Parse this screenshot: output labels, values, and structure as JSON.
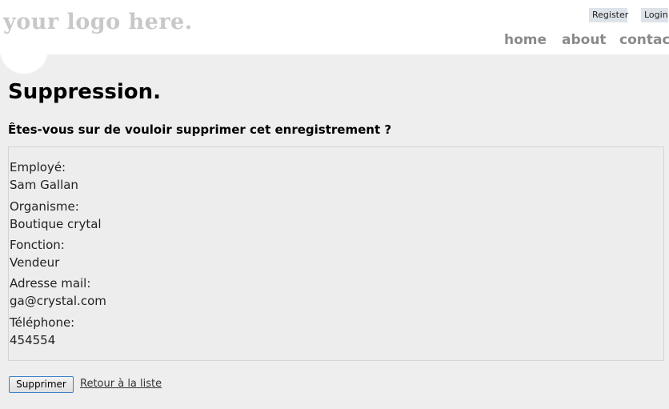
{
  "header": {
    "logo": "your logo here.",
    "auth": {
      "register": "Register",
      "login": "Login"
    },
    "nav": {
      "home": "home",
      "about": "about",
      "contact": "contact"
    }
  },
  "main": {
    "title": "Suppression.",
    "question": "Êtes-vous sur de vouloir supprimer cet enregistrement ?",
    "fields": [
      {
        "label": "Employé:",
        "value": "Sam Gallan"
      },
      {
        "label": "Organisme:",
        "value": "Boutique crytal"
      },
      {
        "label": "Fonction:",
        "value": "Vendeur"
      },
      {
        "label": "Adresse mail:",
        "value": "ga@crystal.com"
      },
      {
        "label": "Téléphone:",
        "value": "454554"
      }
    ],
    "delete_button": "Supprimer",
    "back_link": "Retour à la liste"
  }
}
